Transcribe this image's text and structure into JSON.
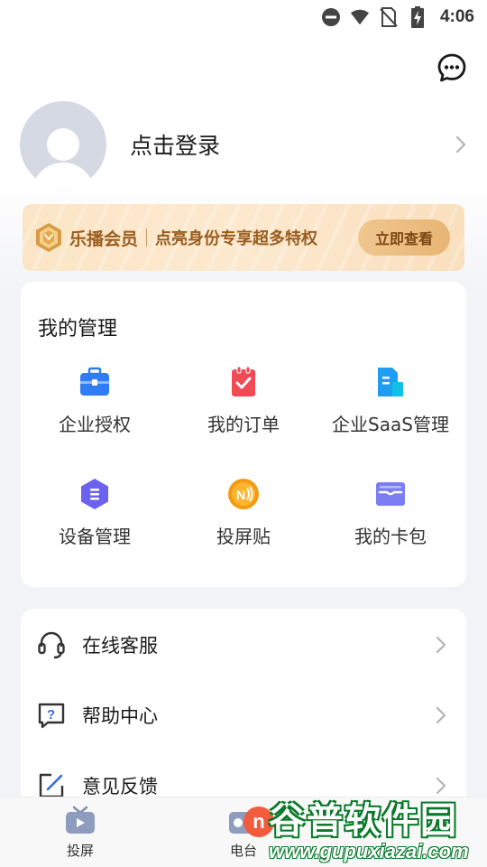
{
  "status_bar": {
    "time": "4:06",
    "icons": [
      "do-not-disturb-icon",
      "wifi-icon",
      "no-sim-icon",
      "battery-charging-icon"
    ]
  },
  "header": {
    "message_icon": "chat-bubble-icon"
  },
  "profile": {
    "login_text": "点击登录"
  },
  "vip_banner": {
    "title": "乐播会员",
    "description": "点亮身份专享超多特权",
    "button_label": "立即查看"
  },
  "management": {
    "title": "我的管理",
    "items": [
      {
        "label": "企业授权",
        "icon": "briefcase-icon",
        "color": "#2f7cf6"
      },
      {
        "label": "我的订单",
        "icon": "order-clipboard-icon",
        "color": "#f04a55"
      },
      {
        "label": "企业SaaS管理",
        "icon": "document-icon",
        "color": "#1f9df0"
      },
      {
        "label": "设备管理",
        "icon": "device-hexagon-icon",
        "color": "#6b63f0"
      },
      {
        "label": "投屏贴",
        "icon": "nfc-sticker-icon",
        "color": "#f59a12"
      },
      {
        "label": "我的卡包",
        "icon": "card-wallet-icon",
        "color": "#7a7ef2"
      }
    ]
  },
  "list": {
    "items": [
      {
        "label": "在线客服",
        "icon": "headset-icon"
      },
      {
        "label": "帮助中心",
        "icon": "help-question-icon"
      },
      {
        "label": "意见反馈",
        "icon": "edit-feedback-icon"
      }
    ]
  },
  "bottom_nav": {
    "items": [
      {
        "label": "投屏",
        "icon": "tv-icon"
      },
      {
        "label": "电台",
        "icon": "radio-icon"
      }
    ],
    "badge_letter": "n"
  },
  "watermark": {
    "title": "谷普软件园",
    "url": "www.gupuxiazai.com"
  }
}
